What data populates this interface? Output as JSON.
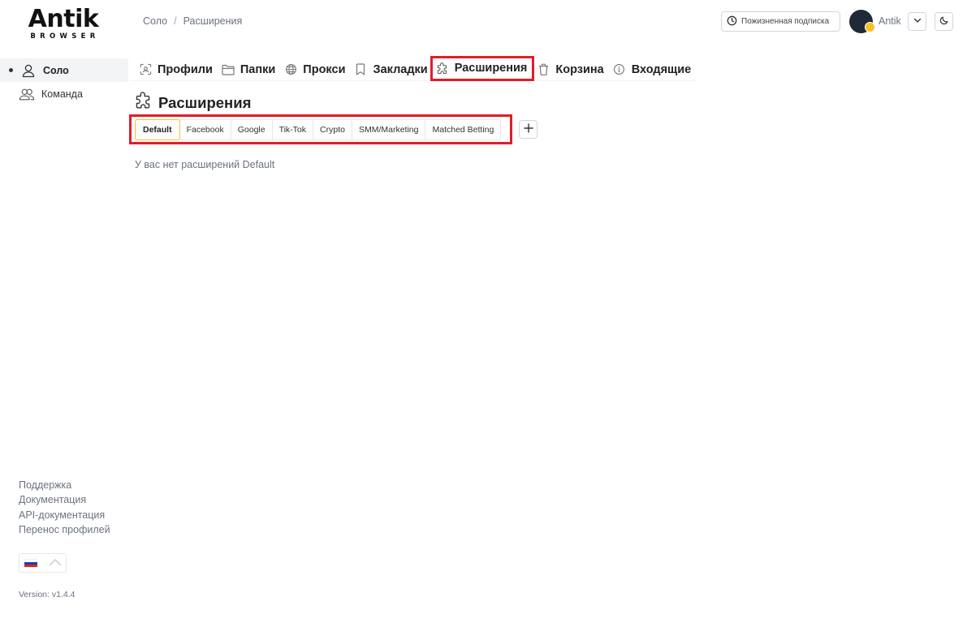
{
  "logo": {
    "word": "Antik",
    "sub": "BROWSER"
  },
  "breadcrumb": {
    "first": "Соло",
    "sep": "/",
    "current": "Расширения"
  },
  "header": {
    "subscription_label": "Пожизненная подписка",
    "user_name": "Antik"
  },
  "sidebar": {
    "items": [
      {
        "label": "Соло",
        "icon": "user-icon",
        "active": true
      },
      {
        "label": "Команда",
        "icon": "team-icon",
        "active": false
      }
    ],
    "links": [
      "Поддержка",
      "Документация",
      "API-документация",
      "Перенос профилей"
    ],
    "version": "Version: v1.4.4"
  },
  "nav": {
    "tabs": [
      {
        "label": "Профили",
        "icon": "profiles-icon"
      },
      {
        "label": "Папки",
        "icon": "folder-icon"
      },
      {
        "label": "Прокси",
        "icon": "globe-icon"
      },
      {
        "label": "Закладки",
        "icon": "bookmark-icon"
      },
      {
        "label": "Расширения",
        "icon": "puzzle-icon",
        "active": true
      },
      {
        "label": "Корзина",
        "icon": "trash-icon"
      },
      {
        "label": "Входящие",
        "icon": "info-icon"
      }
    ]
  },
  "page": {
    "title": "Расширения",
    "folder_tabs": [
      "Default",
      "Facebook",
      "Google",
      "Tik-Tok",
      "Crypto",
      "SMM/Marketing",
      "Matched Betting"
    ],
    "selected_tab": "Default",
    "empty_message": "У вас нет расширений Default"
  },
  "colors": {
    "highlight": "#e11d2a",
    "selected_tab_border": "#fbbf24"
  }
}
